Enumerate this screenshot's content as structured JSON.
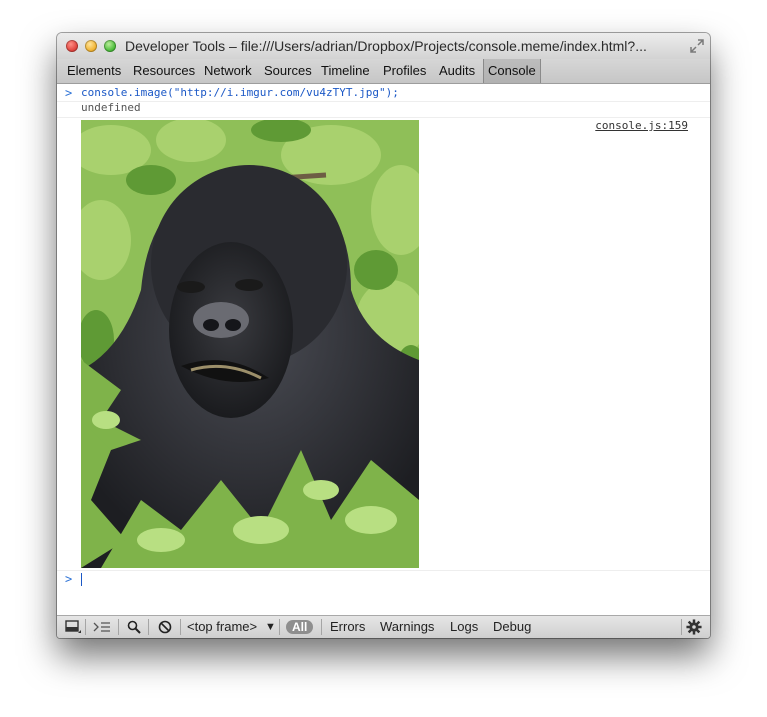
{
  "window": {
    "title": "Developer Tools – file:///Users/adrian/Dropbox/Projects/console.meme/index.html?..."
  },
  "tabs": [
    {
      "label": "Elements"
    },
    {
      "label": "Resources"
    },
    {
      "label": "Network"
    },
    {
      "label": "Sources"
    },
    {
      "label": "Timeline"
    },
    {
      "label": "Profiles"
    },
    {
      "label": "Audits"
    },
    {
      "label": "Console"
    }
  ],
  "active_tab": "Console",
  "console": {
    "prompt_glyph": ">",
    "command": "console.image(\"http://i.imgur.com/vu4zTYT.jpg\");",
    "result": "undefined",
    "source_link": "console.js:159",
    "image_subject": "gorilla photo"
  },
  "statusbar": {
    "frame_select": "<top frame>",
    "frame_arrow": "▼",
    "filters": [
      "All",
      "Errors",
      "Warnings",
      "Logs",
      "Debug"
    ],
    "active_filter": "All"
  },
  "icons": [
    "close-light",
    "minimize-light",
    "zoom-light",
    "resize-icon",
    "dock-icon",
    "clear-console-icon",
    "search-icon",
    "no-entry-icon",
    "gear-icon"
  ],
  "colors": {
    "accent_blue": "#1b58c6",
    "pill_bg": "#8e8e8e"
  }
}
